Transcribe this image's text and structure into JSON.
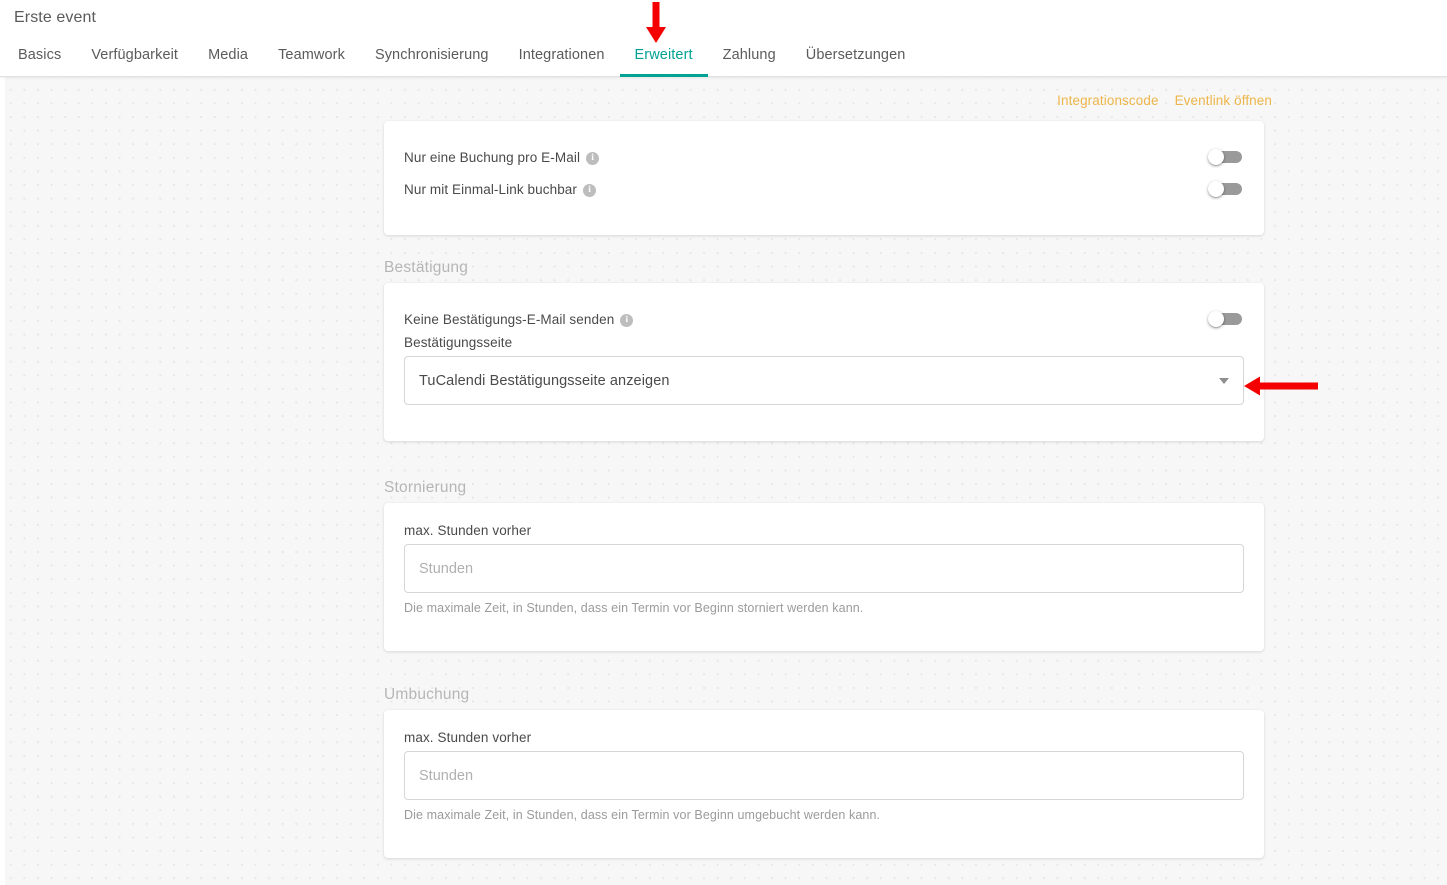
{
  "header": {
    "title": "Erste event",
    "tabs": [
      {
        "label": "Basics",
        "active": false
      },
      {
        "label": "Verfügbarkeit",
        "active": false
      },
      {
        "label": "Media",
        "active": false
      },
      {
        "label": "Teamwork",
        "active": false
      },
      {
        "label": "Synchronisierung",
        "active": false
      },
      {
        "label": "Integrationen",
        "active": false
      },
      {
        "label": "Erweitert",
        "active": true
      },
      {
        "label": "Zahlung",
        "active": false
      },
      {
        "label": "Übersetzungen",
        "active": false
      }
    ]
  },
  "top_links": [
    {
      "label": "Integrationscode"
    },
    {
      "label": "Eventlink öffnen"
    }
  ],
  "options_card": {
    "rows": [
      {
        "label": "Nur eine Buchung pro E-Mail",
        "info": "i",
        "toggle_state": "off"
      },
      {
        "label": "Nur mit Einmal-Link buchbar",
        "info": "i",
        "toggle_state": "off"
      }
    ]
  },
  "confirmation": {
    "section_title": "Bestätigung",
    "toggle_label": "Keine Bestätigungs-E-Mail senden",
    "toggle_info": "i",
    "toggle_state": "off",
    "select_label": "Bestätigungsseite",
    "select_value": "TuCalendi Bestätigungsseite anzeigen"
  },
  "cancellation": {
    "section_title": "Stornierung",
    "field_label": "max. Stunden vorher",
    "input_value": "",
    "input_placeholder": "Stunden",
    "helper_text": "Die maximale Zeit, in Stunden, dass ein Termin vor Beginn storniert werden kann."
  },
  "reschedule": {
    "section_title": "Umbuchung",
    "field_label": "max. Stunden vorher",
    "input_value": "",
    "input_placeholder": "Stunden",
    "helper_text": "Die maximale Zeit, in Stunden, dass ein Termin vor Beginn umgebucht werden kann."
  },
  "annotations": {
    "arrow_color": "#f40000",
    "arrow_down_target": "Erweitert",
    "arrow_left_target": "Bestätigungsseite"
  },
  "colors": {
    "accent_teal": "#00a294",
    "link_amber": "#edb64b",
    "annotation_red": "#f40000",
    "background": "#f7f7f7"
  }
}
